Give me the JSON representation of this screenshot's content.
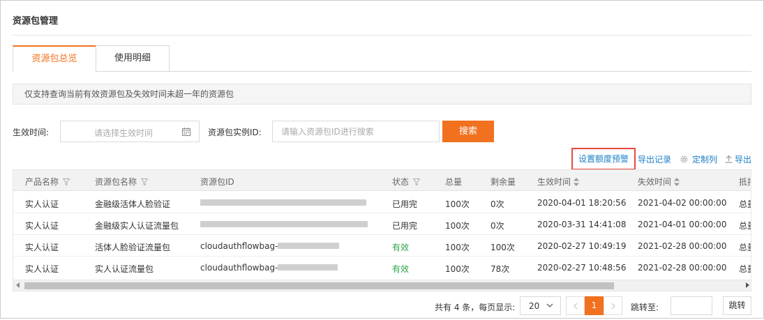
{
  "page": {
    "title": "资源包管理"
  },
  "tabs": [
    {
      "label": "资源包总览",
      "active": true
    },
    {
      "label": "使用明细",
      "active": false
    }
  ],
  "notice": "仅支持查询当前有效资源包及失效时间未超一年的资源包",
  "filters": {
    "date_label": "生效时间:",
    "date_placeholder": "请选择生效时间",
    "id_label": "资源包实例ID:",
    "id_placeholder": "请输入资源包ID进行搜索",
    "search_button": "搜索"
  },
  "actions": {
    "quota_alert": "设置额度预警",
    "export_records": "导出记录",
    "custom_columns": "定制列",
    "export": "导出"
  },
  "table": {
    "headers": {
      "product": "产品名称",
      "package_name": "资源包名称",
      "package_id": "资源包ID",
      "status": "状态",
      "total": "总量",
      "remaining": "剩余量",
      "start_time": "生效时间",
      "end_time": "失效时间",
      "deduct": "抵扣"
    },
    "rows": [
      {
        "product": "实人认证",
        "package_name": "金融级活体人脸验证",
        "package_id": "",
        "status": "已用完",
        "status_color": "#333333",
        "total": "100次",
        "remaining": "0次",
        "start_time": "2020-04-01 18:20:56",
        "end_time": "2021-04-02 00:00:00",
        "deduct": "总量"
      },
      {
        "product": "实人认证",
        "package_name": "金融级实人认证流量包",
        "package_id": "",
        "status": "已用完",
        "status_color": "#333333",
        "total": "100次",
        "remaining": "0次",
        "start_time": "2020-03-31 14:41:08",
        "end_time": "2021-04-01 00:00:00",
        "deduct": "总量"
      },
      {
        "product": "实人认证",
        "package_name": "活体人脸验证流量包",
        "package_id": "cloudauthflowbag-",
        "status": "有效",
        "status_color": "#2ea64a",
        "total": "100次",
        "remaining": "100次",
        "start_time": "2020-02-27 10:49:19",
        "end_time": "2021-02-28 00:00:00",
        "deduct": "总量"
      },
      {
        "product": "实人认证",
        "package_name": "实人认证流量包",
        "package_id": "cloudauthflowbag-",
        "status": "有效",
        "status_color": "#2ea64a",
        "total": "100次",
        "remaining": "78次",
        "start_time": "2020-02-27 10:48:56",
        "end_time": "2021-02-28 00:00:00",
        "deduct": "总量"
      }
    ]
  },
  "pagination": {
    "total_text": "共有 4 条，每页显示:",
    "page_size": "20",
    "current_page": "1",
    "jump_label": "跳转至:",
    "jump_button": "跳转"
  },
  "colors": {
    "accent": "#f1711f",
    "link": "#1b7fc7",
    "highlight_box": "#e8493d",
    "status_active": "#2ea64a"
  }
}
